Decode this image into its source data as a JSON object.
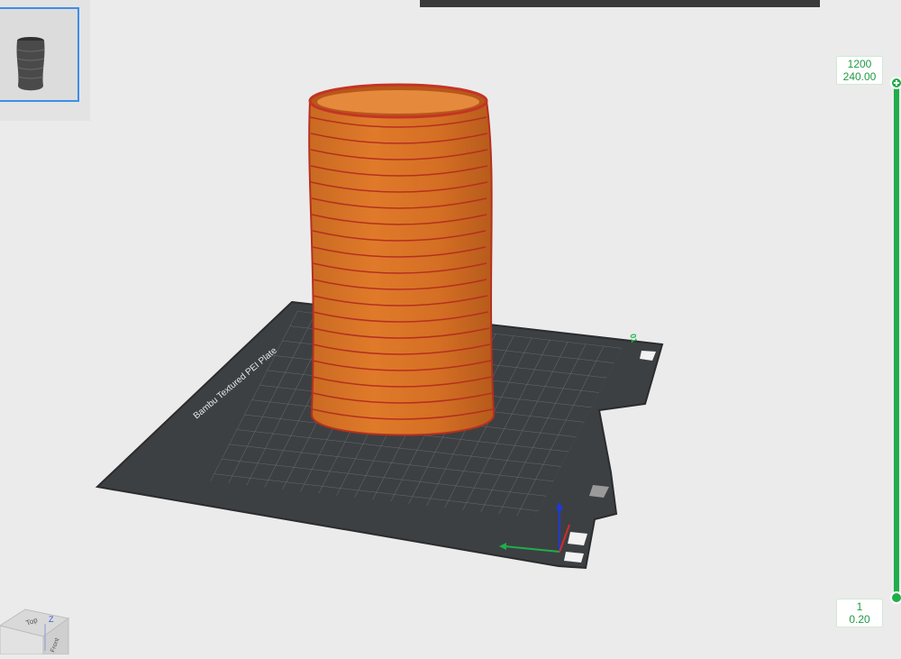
{
  "layer_slider": {
    "top_layer": "1200",
    "top_height": "240.00",
    "bottom_layer": "1",
    "bottom_height": "0.20",
    "accent_color": "#1fae4a"
  },
  "plate": {
    "label": "Bambu Textured PEI Plate",
    "plate_number": "01"
  },
  "view_cube": {
    "top_face": "Top",
    "axis_label": "Z",
    "side_face": "Front"
  },
  "colors": {
    "background": "#ebebeb",
    "plate": "#3d4042",
    "model": "#d2691e",
    "model_edge": "#c0392b",
    "selection": "#3c8ee8"
  },
  "icons": {
    "slider_add": "plus-icon",
    "axis": "axis-gizmo-icon"
  }
}
